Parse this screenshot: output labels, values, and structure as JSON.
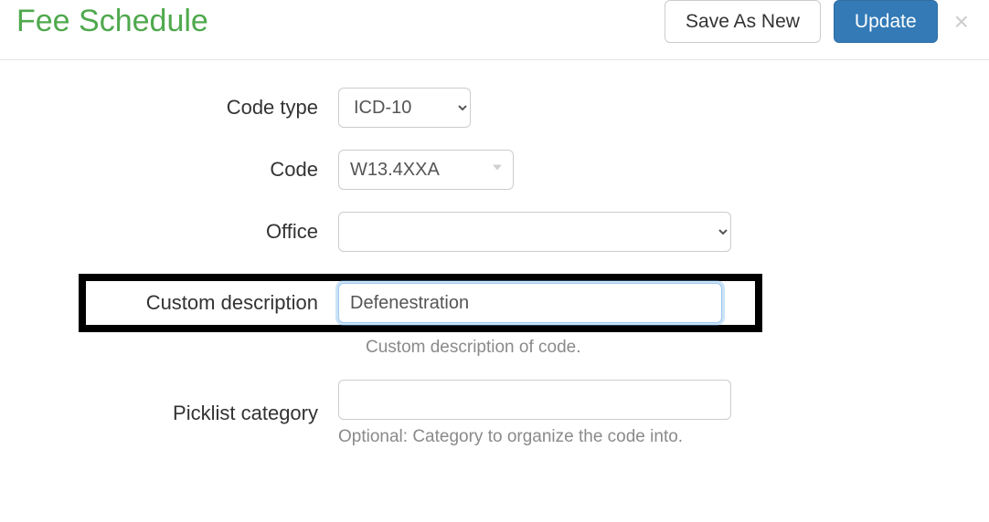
{
  "header": {
    "title": "Fee Schedule",
    "save_as_new": "Save As New",
    "update": "Update",
    "close": "×"
  },
  "form": {
    "code_type": {
      "label": "Code type",
      "value": "ICD-10"
    },
    "code": {
      "label": "Code",
      "value": "W13.4XXA"
    },
    "office": {
      "label": "Office",
      "value": ""
    },
    "custom_description": {
      "label": "Custom description",
      "value": "Defenestration",
      "help": "Custom description of code."
    },
    "picklist_category": {
      "label": "Picklist category",
      "value": "",
      "help": "Optional: Category to organize the code into."
    }
  }
}
